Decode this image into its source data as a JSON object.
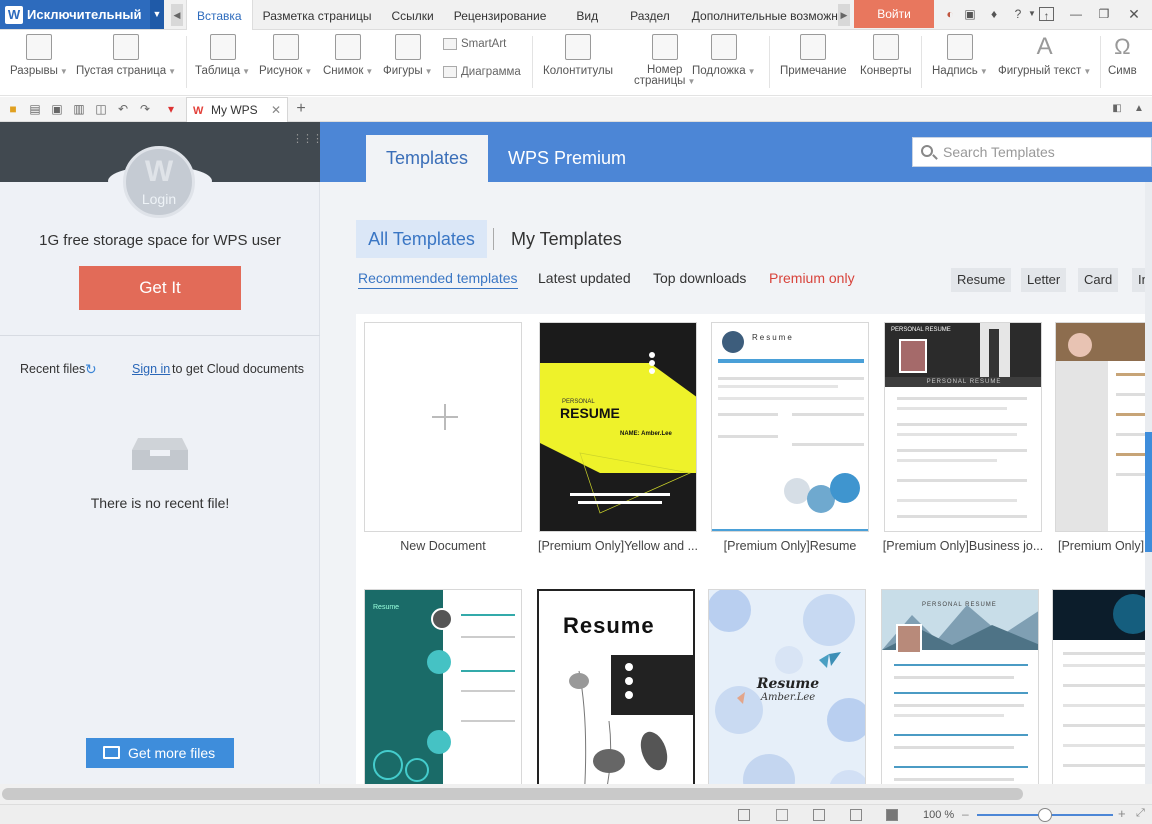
{
  "app": {
    "name": "Исключительный",
    "login_button": "Войти"
  },
  "menu_tabs": [
    "Вставка",
    "Разметка страницы",
    "Ссылки",
    "Рецензирование",
    "Вид",
    "Раздел",
    "Дополнительные возможнос"
  ],
  "ribbon": {
    "items": [
      {
        "label": "Разрывы",
        "icon": "page-breaks-icon"
      },
      {
        "label": "Пустая страница",
        "icon": "blank-page-icon"
      },
      {
        "label": "Таблица",
        "icon": "table-icon"
      },
      {
        "label": "Рисунок",
        "icon": "picture-icon"
      },
      {
        "label": "Снимок",
        "icon": "screenshot-icon"
      },
      {
        "label": "Фигуры",
        "icon": "shapes-icon"
      },
      {
        "label": "Колонтитулы",
        "icon": "header-footer-icon"
      },
      {
        "label": "Номер",
        "label2": "страницы",
        "icon": "page-number-icon"
      },
      {
        "label": "Подложка",
        "icon": "watermark-icon"
      },
      {
        "label": "Примечание",
        "icon": "comment-icon"
      },
      {
        "label": "Конверты",
        "icon": "envelope-icon"
      },
      {
        "label": "Надпись",
        "icon": "textbox-icon"
      },
      {
        "label": "Фигурный текст",
        "icon": "wordart-icon"
      },
      {
        "label": "Симв",
        "icon": "symbol-icon"
      }
    ],
    "smartart": "SmartArt",
    "chart": "Диаграмма"
  },
  "doc_tab": {
    "label": "My WPS"
  },
  "left_panel": {
    "avatar_label": "Login",
    "storage_text": "1G free storage space for WPS user",
    "get_it": "Get It",
    "recent_files": "Recent files",
    "sign_in": "Sign in",
    "sign_in_rest": "to get Cloud documents",
    "no_recent": "There is no recent file!",
    "get_more": "Get more files"
  },
  "main": {
    "tabs": [
      "Templates",
      "WPS Premium"
    ],
    "search_placeholder": "Search Templates",
    "sub_tabs": [
      "All Templates",
      "My Templates"
    ],
    "filters": [
      "Recommended templates",
      "Latest updated",
      "Top downloads",
      "Premium only"
    ],
    "tags": [
      "Resume",
      "Letter",
      "Card",
      "In"
    ],
    "cards": [
      {
        "caption": "New Document"
      },
      {
        "caption": "[Premium Only]Yellow and ..."
      },
      {
        "caption": "[Premium Only]Resume"
      },
      {
        "caption": "[Premium Only]Business jo..."
      },
      {
        "caption": "[Premium Only]U"
      }
    ],
    "card_texts": {
      "yellow_personal": "PERSONAL",
      "yellow_resume": "RESUME",
      "yellow_name": "NAME: Amber.Lee",
      "resume_head": "Resume",
      "biz_title": "PERSONAL RESUME",
      "biz_sub": "PERSONAL RESUME",
      "row2_resume": "Resume",
      "floral_resume": "Resume",
      "floral_name": "Amber.Lee",
      "row2_personal": "PERSONAL RESUME"
    }
  },
  "status": {
    "zoom": "100 %"
  },
  "colors": {
    "brand_blue": "#2d6bbd",
    "login_orange": "#e8775e",
    "get_it": "#e26b58",
    "header_blue": "#4c86d6",
    "premium_red": "#d8433b"
  }
}
